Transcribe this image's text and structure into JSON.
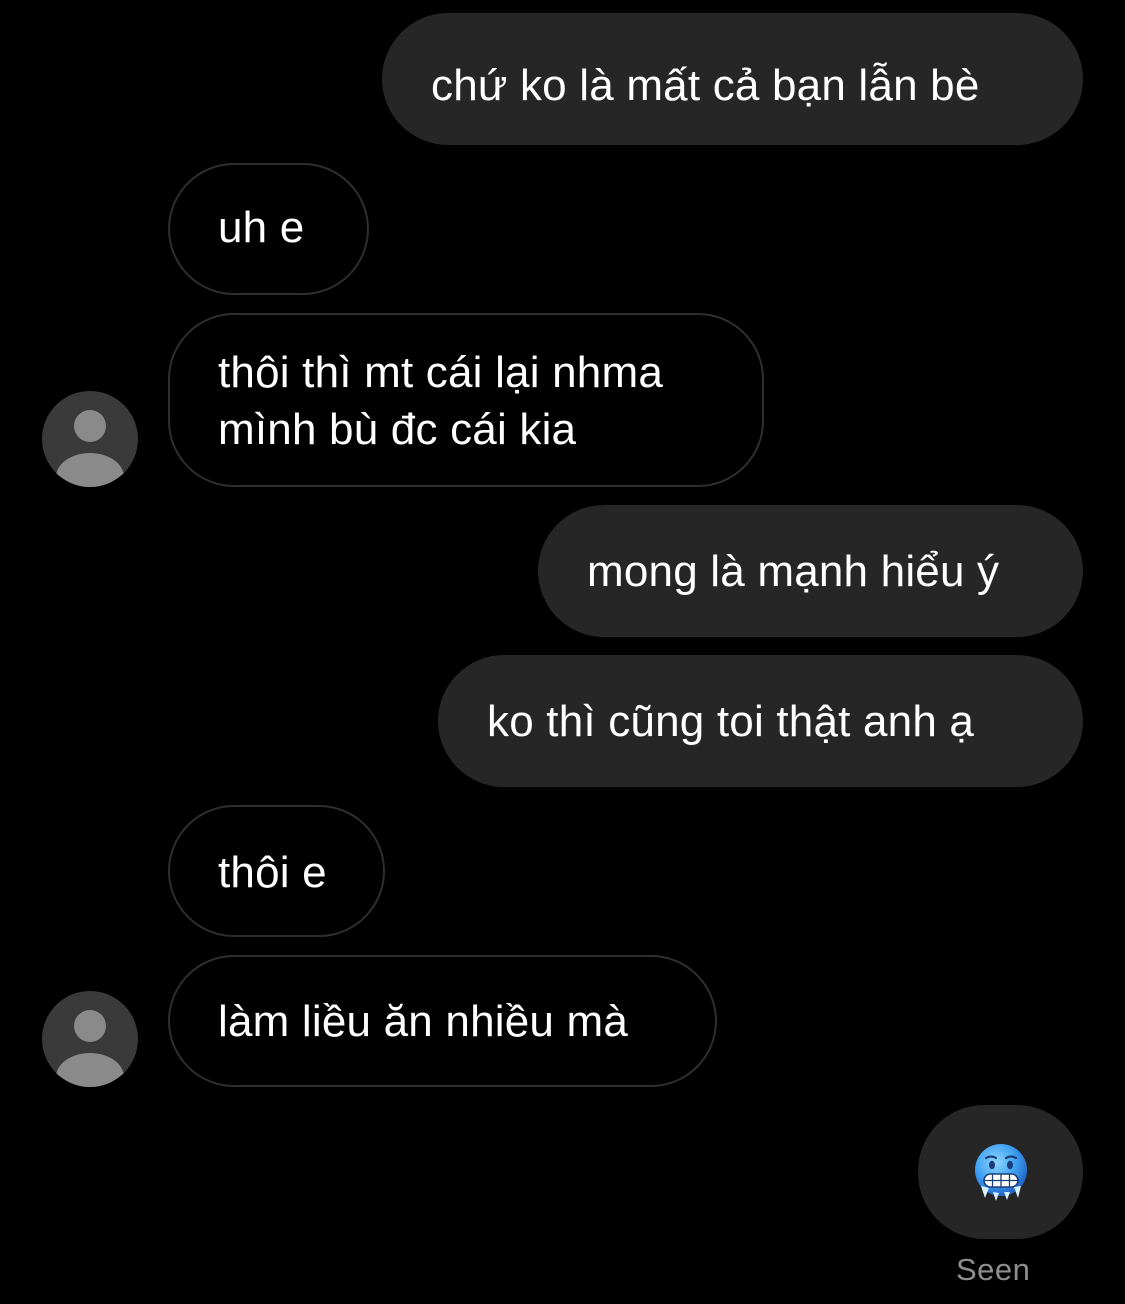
{
  "conversation": {
    "messages": [
      {
        "direction": "outgoing",
        "text": "chứ ko là mất cả bạn lẫn bè"
      },
      {
        "direction": "incoming",
        "text": "uh e"
      },
      {
        "direction": "incoming",
        "lines": [
          "thôi thì mt cái lại nhma",
          "mình bù đc cái kia"
        ]
      },
      {
        "direction": "outgoing",
        "text": "mong là mạnh hiểu ý"
      },
      {
        "direction": "outgoing",
        "text": "ko thì cũng toi thật anh ạ"
      },
      {
        "direction": "incoming",
        "text": "thôi e"
      },
      {
        "direction": "incoming",
        "text": "làm liều ăn nhiều mà"
      },
      {
        "direction": "outgoing",
        "emoji": "cold-face-emoji"
      }
    ],
    "status": "Seen"
  },
  "icons": {
    "avatar": "default-profile-silhouette-icon",
    "sticker": "cold-face-emoji"
  },
  "colors": {
    "background": "#000000",
    "outgoing_bubble": "#262626",
    "incoming_border": "#2e2e2e",
    "text": "#ffffff",
    "seen_text": "#8e8e8e",
    "avatar_bg": "#3a3a3a",
    "avatar_figure": "#8a8a8a"
  }
}
